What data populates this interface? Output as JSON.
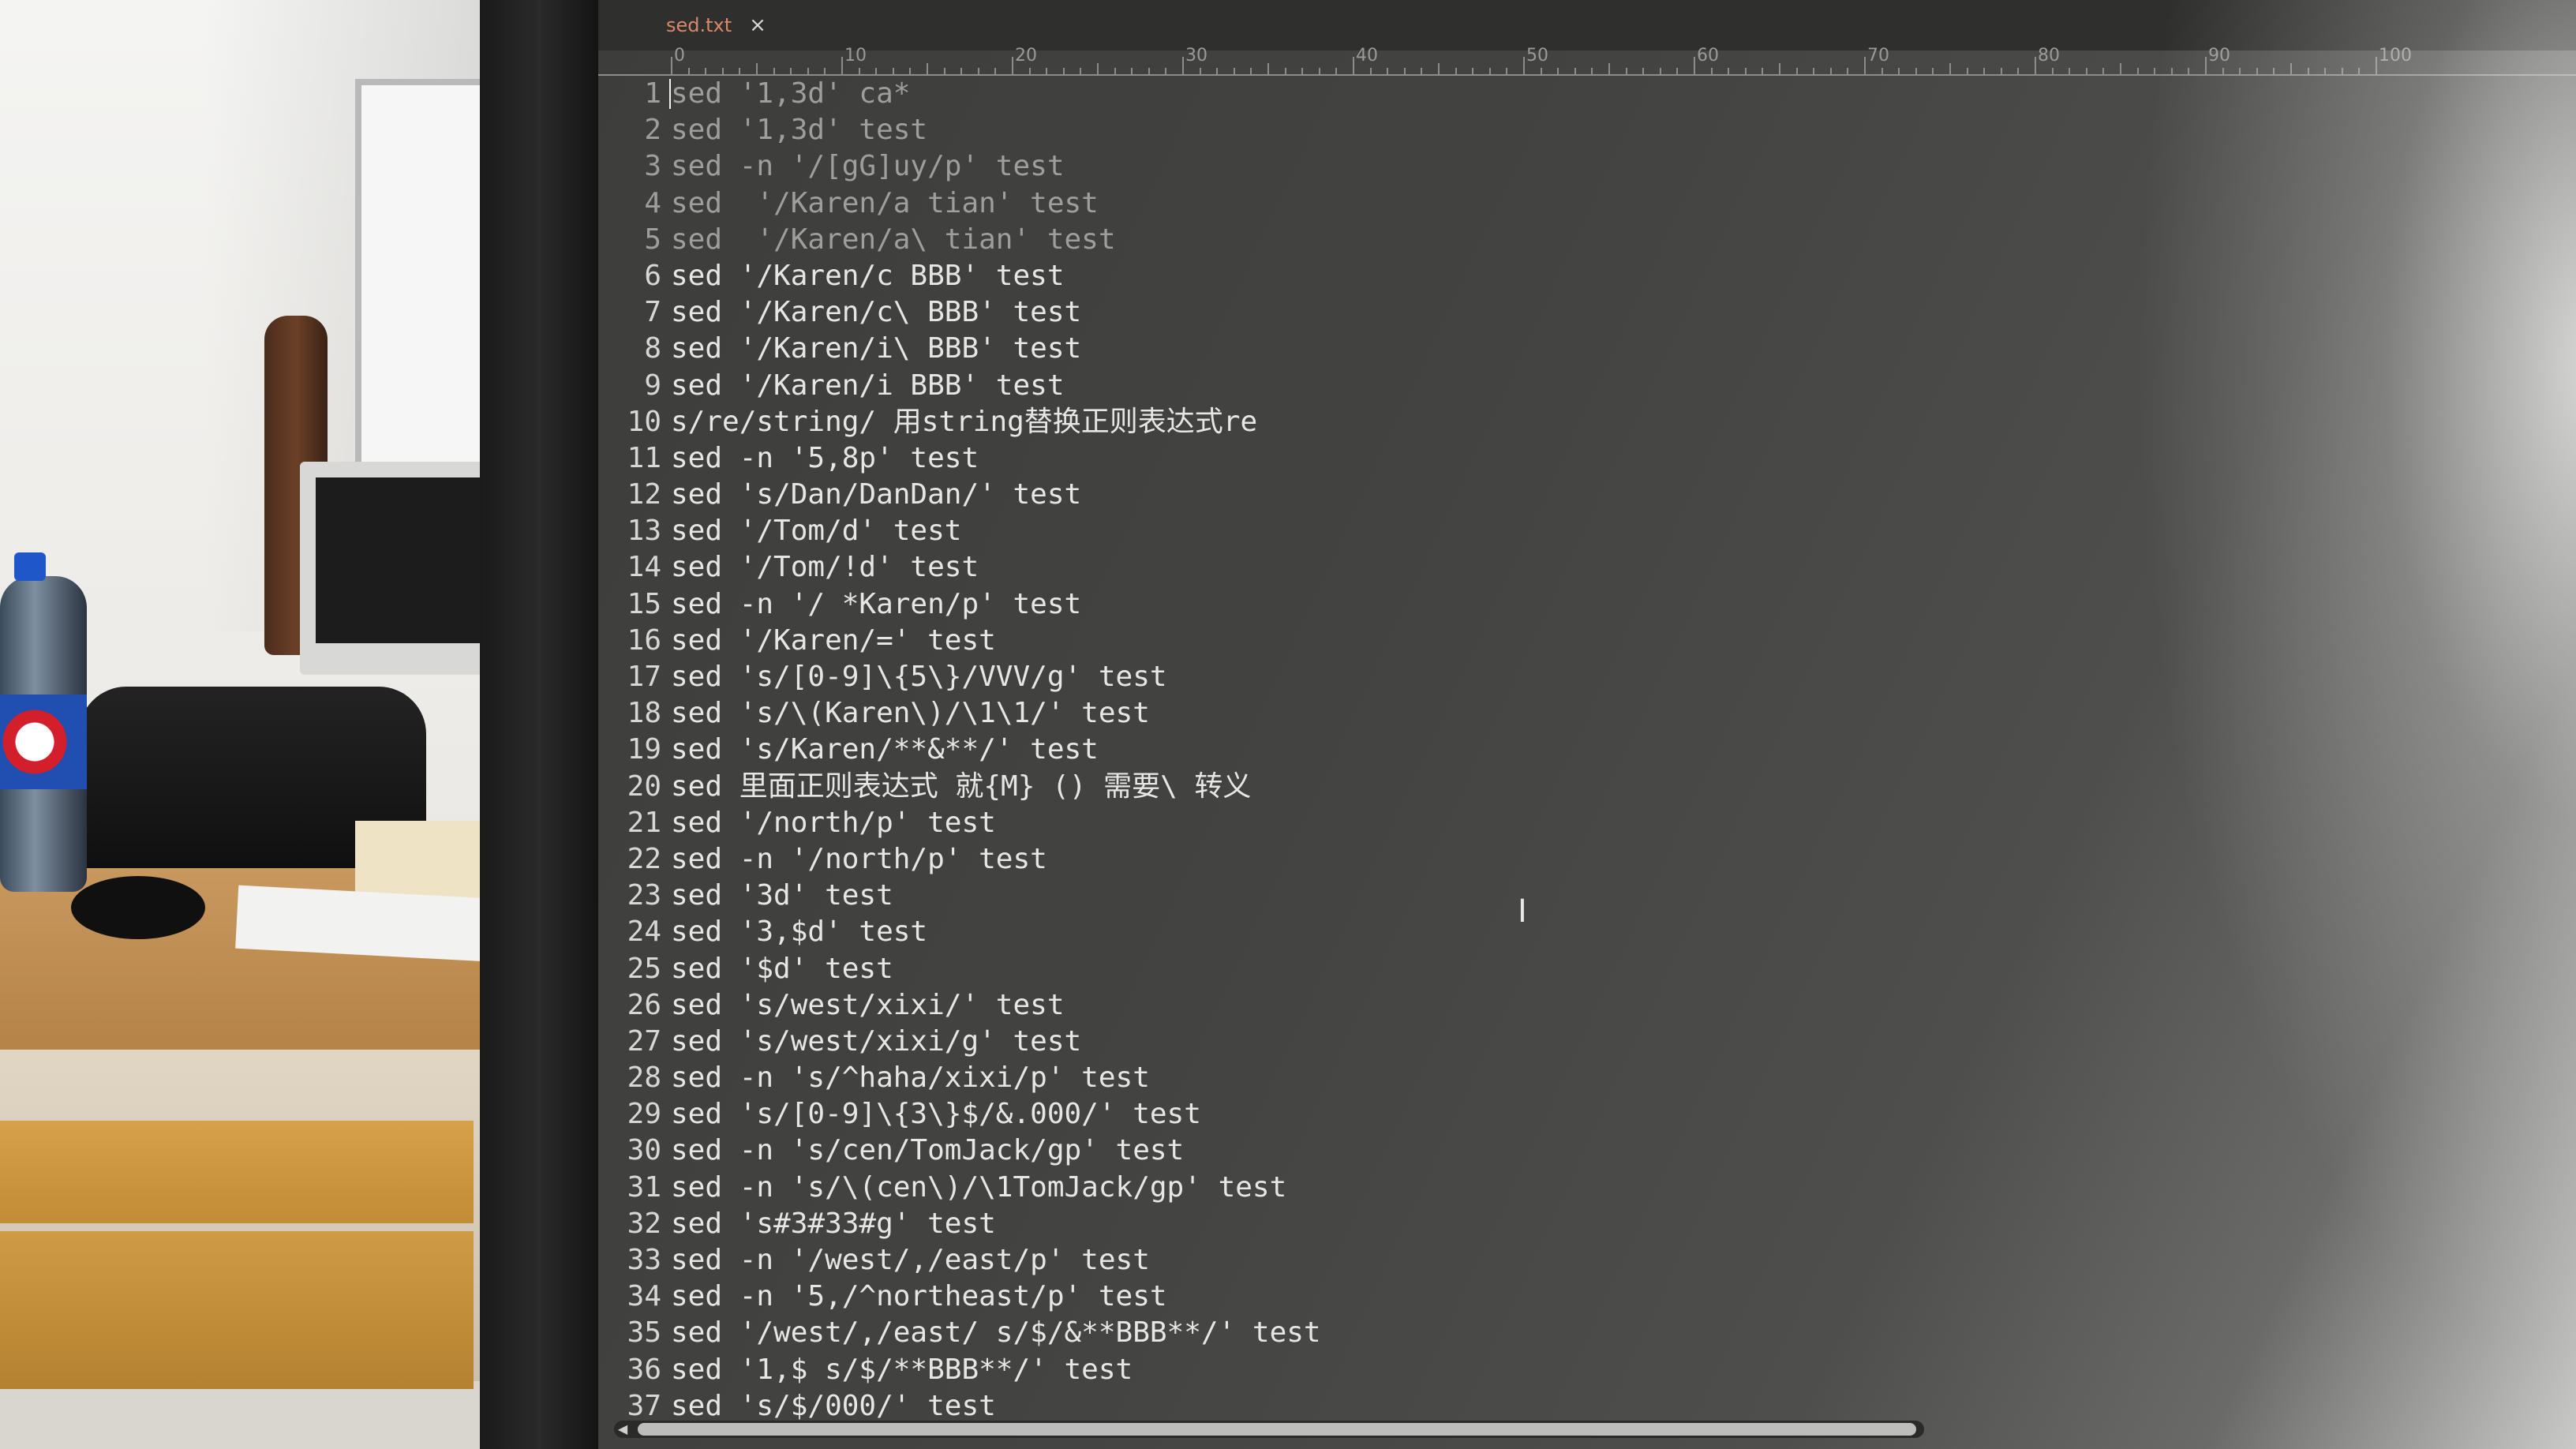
{
  "editor": {
    "tab": {
      "filename": "sed.txt",
      "close_glyph": "×"
    },
    "ruler_labels": [
      "0",
      "10",
      "20",
      "30",
      "40",
      "50",
      "60",
      "70",
      "80",
      "90",
      "100"
    ],
    "lines": [
      {
        "n": "1",
        "text": "sed '1,3d' ca*"
      },
      {
        "n": "2",
        "text": "sed '1,3d' test"
      },
      {
        "n": "3",
        "text": "sed -n '/[gG]uy/p' test"
      },
      {
        "n": "4",
        "text": "sed  '/Karen/a tian' test"
      },
      {
        "n": "5",
        "text": "sed  '/Karen/a\\ tian' test"
      },
      {
        "n": "6",
        "text": "sed '/Karen/c BBB' test"
      },
      {
        "n": "7",
        "text": "sed '/Karen/c\\ BBB' test"
      },
      {
        "n": "8",
        "text": "sed '/Karen/i\\ BBB' test"
      },
      {
        "n": "9",
        "text": "sed '/Karen/i BBB' test"
      },
      {
        "n": "10",
        "text": "s/re/string/ 用string替换正则表达式re"
      },
      {
        "n": "11",
        "text": "sed -n '5,8p' test"
      },
      {
        "n": "12",
        "text": "sed 's/Dan/DanDan/' test"
      },
      {
        "n": "13",
        "text": "sed '/Tom/d' test"
      },
      {
        "n": "14",
        "text": "sed '/Tom/!d' test"
      },
      {
        "n": "15",
        "text": "sed -n '/ *Karen/p' test"
      },
      {
        "n": "16",
        "text": "sed '/Karen/=' test"
      },
      {
        "n": "17",
        "text": "sed 's/[0-9]\\{5\\}/VVV/g' test"
      },
      {
        "n": "18",
        "text": "sed 's/\\(Karen\\)/\\1\\1/' test"
      },
      {
        "n": "19",
        "text": "sed 's/Karen/**&**/' test"
      },
      {
        "n": "20",
        "text": "sed 里面正则表达式 就{M} () 需要\\ 转义"
      },
      {
        "n": "21",
        "text": "sed '/north/p' test"
      },
      {
        "n": "22",
        "text": "sed -n '/north/p' test"
      },
      {
        "n": "23",
        "text": "sed '3d' test"
      },
      {
        "n": "24",
        "text": "sed '3,$d' test"
      },
      {
        "n": "25",
        "text": "sed '$d' test"
      },
      {
        "n": "26",
        "text": "sed 's/west/xixi/' test"
      },
      {
        "n": "27",
        "text": "sed 's/west/xixi/g' test"
      },
      {
        "n": "28",
        "text": "sed -n 's/^haha/xixi/p' test"
      },
      {
        "n": "29",
        "text": "sed 's/[0-9]\\{3\\}$/&.000/' test"
      },
      {
        "n": "30",
        "text": "sed -n 's/cen/TomJack/gp' test"
      },
      {
        "n": "31",
        "text": "sed -n 's/\\(cen\\)/\\1TomJack/gp' test"
      },
      {
        "n": "32",
        "text": "sed 's#3#33#g' test"
      },
      {
        "n": "33",
        "text": "sed -n '/west/,/east/p' test"
      },
      {
        "n": "34",
        "text": "sed -n '5,/^northeast/p' test"
      },
      {
        "n": "35",
        "text": "sed '/west/,/east/ s/$/&**BBB**/' test"
      },
      {
        "n": "36",
        "text": "sed '1,$ s/$/**BBB**/' test"
      },
      {
        "n": "37",
        "text": "sed 's/$/000/' test"
      }
    ],
    "mouse_cursor": "I",
    "scroll_arrow": "◀"
  },
  "colors": {
    "tab_label": "#d9896b",
    "text": "#e6e6e4",
    "background": "#3d3d3b"
  },
  "icons": {
    "close": "close-icon",
    "text_cursor": "ibeam-cursor-icon",
    "scroll_left": "chevron-left-icon"
  }
}
